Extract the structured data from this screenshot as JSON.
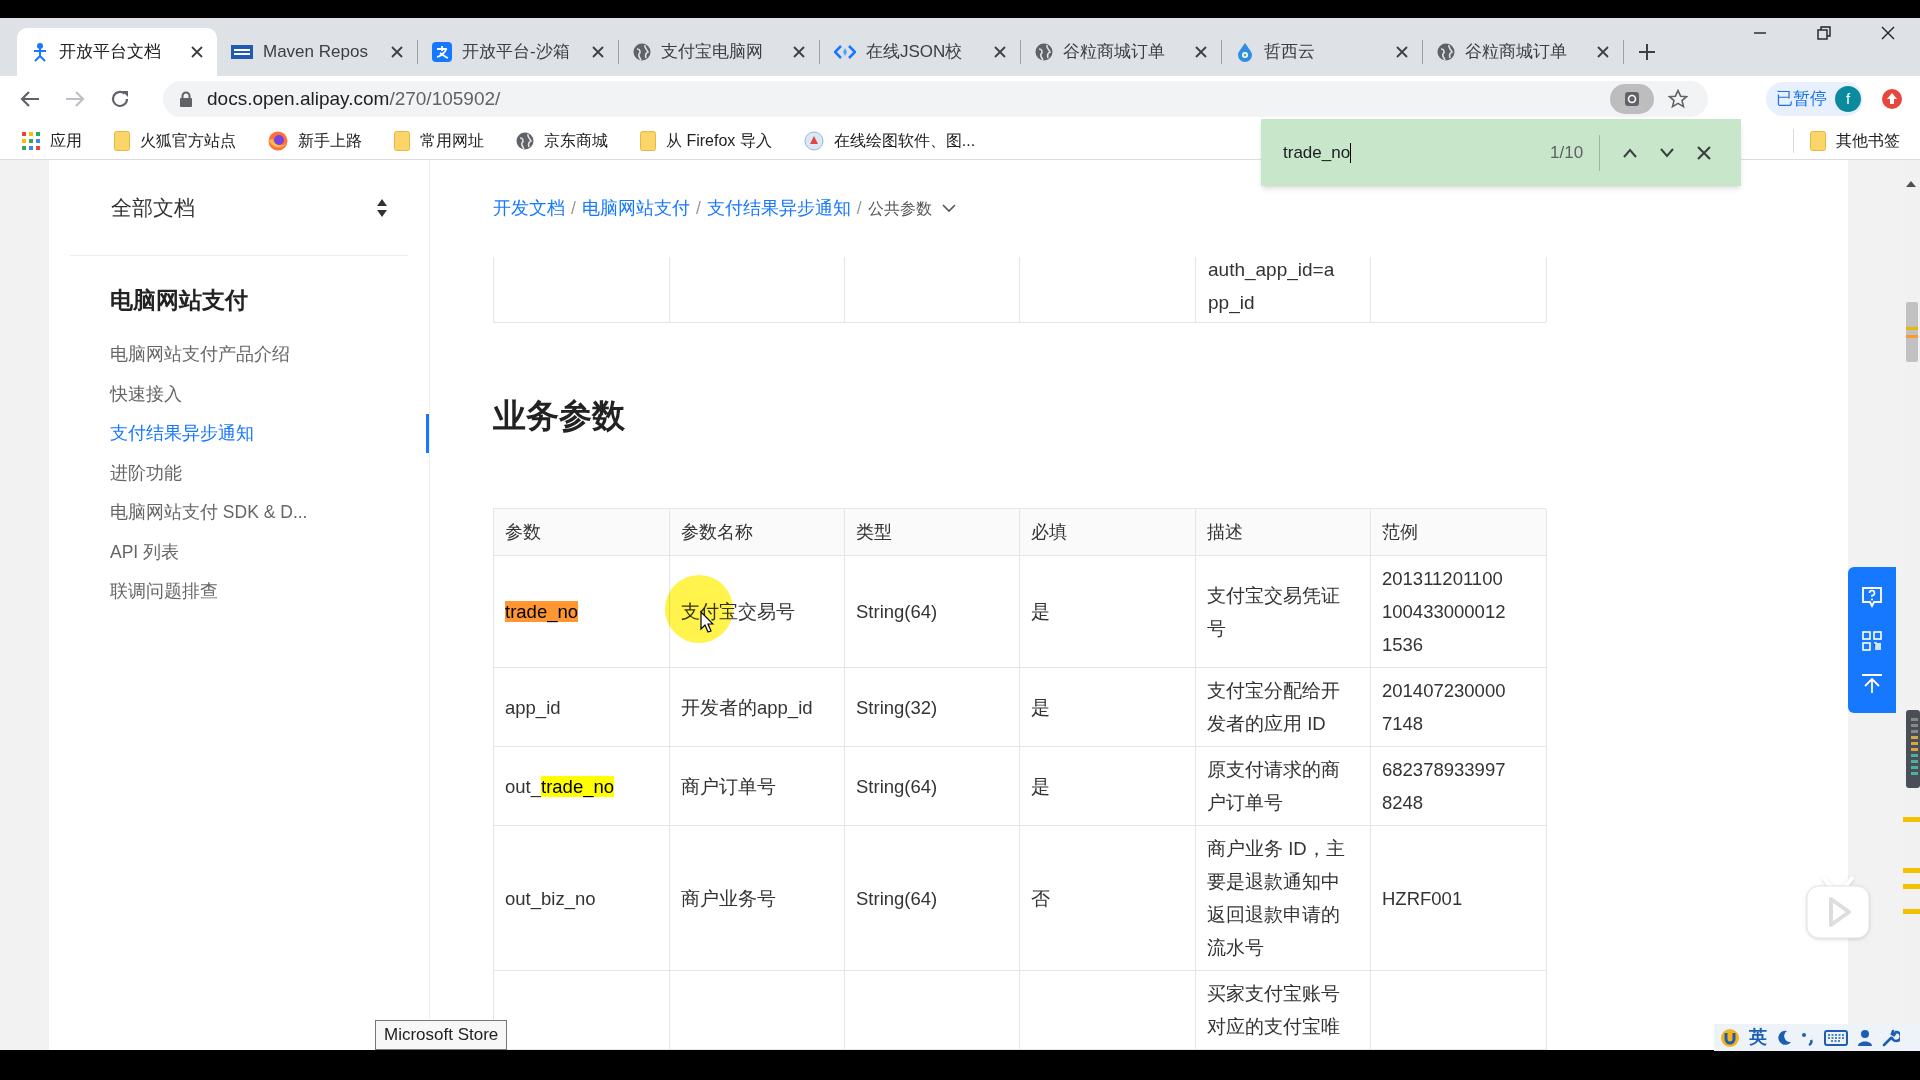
{
  "browser": {
    "tabs": [
      {
        "label": "开放平台文档",
        "selected": true
      },
      {
        "label": "Maven Repos",
        "selected": false
      },
      {
        "label": "开放平台-沙箱",
        "selected": false
      },
      {
        "label": "支付宝电脑网",
        "selected": false
      },
      {
        "label": "在线JSON校",
        "selected": false
      },
      {
        "label": "谷粒商城订单",
        "selected": false
      },
      {
        "label": "哲西云",
        "selected": false
      },
      {
        "label": "谷粒商城订单",
        "selected": false
      }
    ],
    "address": {
      "host": "docs.open.alipay.com",
      "path": "/270/105902/"
    },
    "profile": {
      "label": "已暂停",
      "avatar": "f"
    },
    "bookmarks": [
      "应用",
      "火狐官方站点",
      "新手上路",
      "常用网址",
      "京东商城",
      "从 Firefox 导入",
      "在线绘图软件、图..."
    ],
    "other_bookmarks": "其他书签"
  },
  "find_bar": {
    "query": "trade_no",
    "count": "1/10"
  },
  "sidebar": {
    "title": "全部文档",
    "section": "电脑网站支付",
    "items": [
      {
        "label": "电脑网站支付产品介绍",
        "selected": false
      },
      {
        "label": "快速接入",
        "selected": false
      },
      {
        "label": "支付结果异步通知",
        "selected": true
      },
      {
        "label": "进阶功能",
        "selected": false
      },
      {
        "label": "电脑网站支付 SDK & D...",
        "selected": false
      },
      {
        "label": "API 列表",
        "selected": false
      },
      {
        "label": "联调问题排查",
        "selected": false
      }
    ]
  },
  "breadcrumb": [
    {
      "label": "开发文档",
      "kind": "link"
    },
    {
      "separator": "/",
      "label": "电脑网站支付",
      "kind": "link"
    },
    {
      "separator": "/",
      "label": "支付结果异步通知",
      "kind": "link"
    },
    {
      "separator": "/",
      "label": "公共参数",
      "kind": "current"
    }
  ],
  "previous_table_tail": {
    "description": "auth_app_id=app_id"
  },
  "section_heading": "业务参数",
  "table": {
    "columns": [
      "参数",
      "参数名称",
      "类型",
      "必填",
      "描述",
      "范例"
    ],
    "rows": [
      {
        "param": [
          {
            "text": "trade_no",
            "kind": "current"
          }
        ],
        "name": "支付宝交易号",
        "type": "String(64)",
        "required": "是",
        "description": "支付宝交易凭证号",
        "example": "2013112011001004330000121536"
      },
      {
        "param": [
          {
            "text": "app_id",
            "kind": "plain"
          }
        ],
        "name": "开发者的app_id",
        "type": "String(32)",
        "required": "是",
        "description": "支付宝分配给开发者的应用 ID",
        "example": "2014072300007148"
      },
      {
        "param": [
          {
            "text": "out_",
            "kind": "plain"
          },
          {
            "text": "trade_no",
            "kind": "match"
          }
        ],
        "name": "商户订单号",
        "type": "String(64)",
        "required": "是",
        "description": "原支付请求的商户订单号",
        "example": "6823789339978248"
      },
      {
        "param": [
          {
            "text": "out_biz_no",
            "kind": "plain"
          }
        ],
        "name": "商户业务号",
        "type": "String(64)",
        "required": "否",
        "description": "商户业务 ID，主要是退款通知中返回退款申请的流水号",
        "example": "HZRF001"
      },
      {
        "description": "买家支付宝账号对应的支付宝唯"
      }
    ]
  },
  "tooltip": "Microsoft Store",
  "ime": {
    "language": "英"
  }
}
